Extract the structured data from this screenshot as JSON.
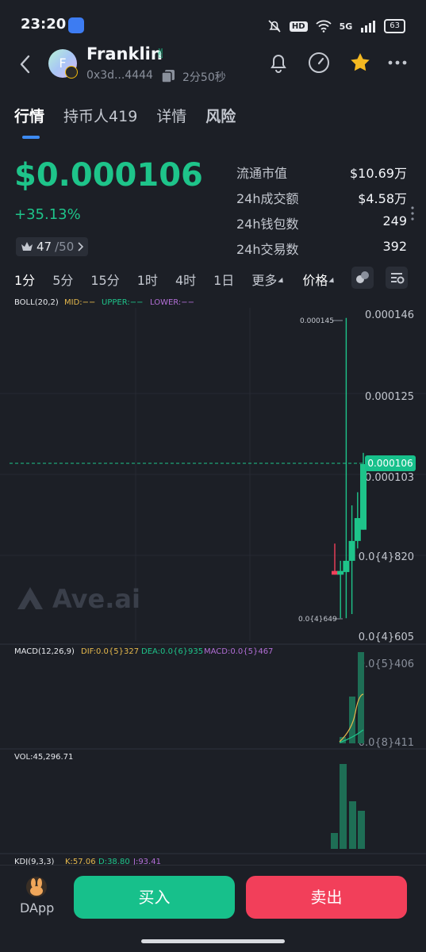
{
  "status_bar": {
    "time": "23:20",
    "hd": "HD",
    "network": "5G",
    "battery": "63"
  },
  "header": {
    "avatar_letter": "F",
    "token_name": "Franklin",
    "address": "0x3d...4444",
    "age": "2分50秒"
  },
  "tabs": [
    {
      "label": "行情"
    },
    {
      "label": "持币人419"
    },
    {
      "label": "详情"
    },
    {
      "label": "风险"
    }
  ],
  "price": {
    "value": "$0.000106",
    "change": "+35.13%",
    "rank_current": "47",
    "rank_total": "/50"
  },
  "stats": [
    {
      "label": "流通市值",
      "value": "$10.69万"
    },
    {
      "label": "24h成交额",
      "value": "$4.58万"
    },
    {
      "label": "24h钱包数",
      "value": "249"
    },
    {
      "label": "24h交易数",
      "value": "392"
    }
  ],
  "intervals": [
    "1分",
    "5分",
    "15分",
    "1时",
    "4时",
    "1日",
    "更多",
    "价格"
  ],
  "chart": {
    "boll_label": "BOLL(20,2)",
    "boll_mid": "MID:−−",
    "boll_upper": "UPPER:−−",
    "boll_lower": "LOWER:−−",
    "y_labels": [
      "0.000146",
      "0.000125",
      "0.000103",
      "0.0{4}820",
      "0.0{4}605"
    ],
    "high_marker": "0.000145",
    "low_marker": "0.0{4}649",
    "current_price_tag": "0.000106",
    "watermark": "Ave.ai",
    "macd_label": "MACD(12,26,9)",
    "macd_dif": "DIF:0.0{5}327",
    "macd_dea": "DEA:0.0{6}935",
    "macd_macd": "MACD:0.0{5}467",
    "macd_y_top": "0.0{5}406",
    "macd_y_bottom": "0.0{8}411",
    "vol_label": "VOL:45,296.71",
    "kdj_label": "KDJ(9,3,3)",
    "kdj_k": "K:57.06",
    "kdj_d": "D:38.80",
    "kdj_j": "J:93.41",
    "colors": {
      "up": "#1ec48a",
      "down": "#f23f5a",
      "mid": "#e5b84c",
      "upper": "#1ec48a",
      "lower": "#b26ed6"
    }
  },
  "chart_data": {
    "type": "candlestick",
    "candles": [
      {
        "open": 7.75e-05,
        "close": 7.65e-05,
        "high": 8.48e-05,
        "low": 7.65e-05
      },
      {
        "open": 7.65e-05,
        "close": 7.75e-05,
        "high": 8.02e-05,
        "low": 6.49e-05
      },
      {
        "open": 7.72e-05,
        "close": 8.02e-05,
        "high": 0.000145,
        "low": 6.49e-05
      },
      {
        "open": 8.02e-05,
        "close": 8.55e-05,
        "high": 9.5e-05,
        "low": 6.6e-05
      },
      {
        "open": 8.55e-05,
        "close": 9.16e-05,
        "high": 9.85e-05,
        "low": 8.35e-05
      },
      {
        "open": 8.85e-05,
        "close": 0.000106,
        "high": 0.000109,
        "low": 8.85e-05
      }
    ],
    "ylim": [
      6.05e-05,
      0.000146
    ]
  },
  "bottom": {
    "dapp": "DApp",
    "buy": "买入",
    "sell": "卖出"
  }
}
